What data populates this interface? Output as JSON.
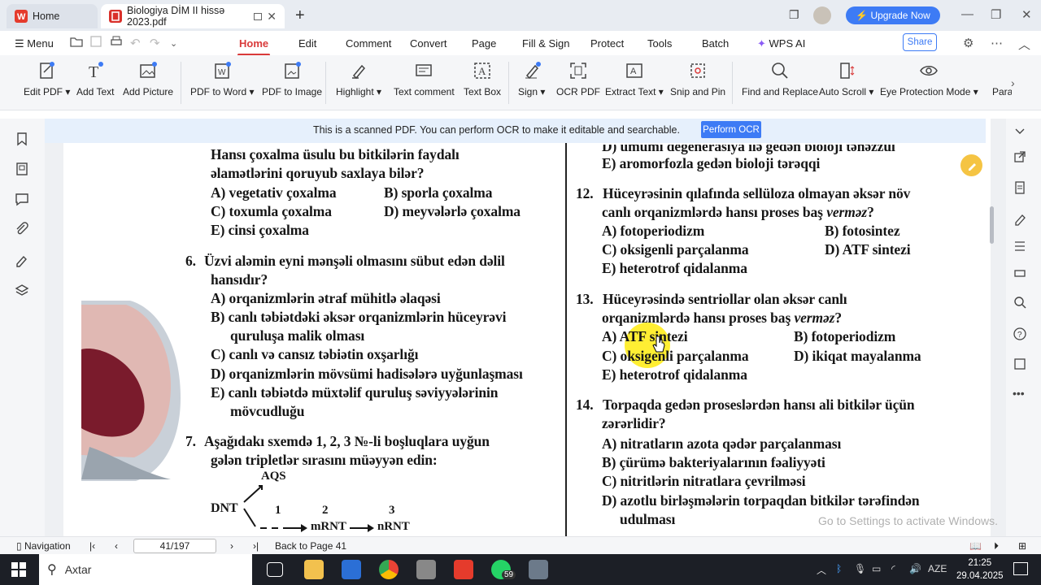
{
  "tabs": {
    "home": "Home",
    "doc": "Biologiya DİM II hissə 2023.pdf"
  },
  "upgrade": "Upgrade Now",
  "menu": {
    "menu_label": "Menu",
    "items": [
      "Home",
      "Edit",
      "Comment",
      "Convert",
      "Page",
      "Fill & Sign",
      "Protect",
      "Tools",
      "Batch",
      "WPS AI"
    ],
    "share": "Share"
  },
  "ribbon": {
    "items": [
      "Edit PDF",
      "Add Text",
      "Add Picture",
      "PDF to Word",
      "PDF to Image",
      "Highlight",
      "Text comment",
      "Text Box",
      "Sign",
      "OCR PDF",
      "Extract Text",
      "Snip and Pin",
      "Find and Replace",
      "Auto Scroll",
      "Eye Protection Mode",
      "Para"
    ]
  },
  "ocr": {
    "message": "This is a scanned PDF. You can perform OCR to make it editable and searchable.",
    "button": "Perform OCR"
  },
  "doc": {
    "left": [
      "Hansı çoxalma üsulu bu bitkilərin faydalı",
      "əlamətlərini qoruyub saxlaya bilər?",
      "A) vegetativ çoxalma",
      "B) sporla çoxalma",
      "C) toxumla çoxalma",
      "D) meyvələrlə çoxalma",
      "E) cinsi çoxalma",
      "6.",
      "Üzvi aləmin eyni mənşəli olmasını sübut edən dəlil",
      "hansıdır?",
      "A) orqanizmlərin ətraf mühitlə əlaqəsi",
      "B) canlı təbiətdəki əksər orqanizmlərin hüceyrəvi",
      "quruluşa malik olması",
      "C) canlı və cansız təbiətin oxşarlığı",
      "D) orqanizmlərin mövsümi hadisələrə uyğunlaşması",
      "E) canlı təbiətdə müxtəlif quruluş səviyyələrinin",
      "mövcudluğu",
      "7.",
      "Aşağıdakı sxemdə 1, 2, 3 №-li boşluqlara uyğun",
      "gələn tripletlər sırasını müəyyən edin:",
      "AQS",
      "DNT",
      "1",
      "2",
      "3",
      "mRNT",
      "nRNT"
    ],
    "right": [
      "D) ümumi degenerasiya ilə gedən bioloji tənəzzül",
      "E) aromorfozla gedən bioloji tərəqqi",
      "12.",
      "Hüceyrəsinin qılafında sellüloza olmayan əksər növ",
      "canlı orqanizmlərdə hansı proses baş ",
      "verməz",
      "?",
      "A) fotoperiodizm",
      "B) fotosintez",
      "C) oksigenli parçalanma",
      "D) ATF sintezi",
      "E) heterotrof qidalanma",
      "13.",
      "Hüceyrəsində sentriollar olan əksər canlı",
      "orqanizmlərdə hansı proses baş ",
      "verməz",
      "?",
      "A) ATF sintezi",
      "B) fotoperiodizm",
      "C) oksigenli parçalanma",
      "D) ikiqat mayalanma",
      "E) heterotrof qidalanma",
      "14.",
      "Torpaqda gedən proseslərdən hansı ali bitkilər üçün",
      "zərərlidir?",
      "A) nitratların azota qədər parçalanması",
      "B) çürümə bakteriyalarının fəaliyyəti",
      "C) nitritlərin nitratlara çevrilməsi",
      "D) azotlu birləşmələrin torpaqdan bitkilər tərəfindən",
      "udulması"
    ]
  },
  "watermark": "Go to Settings to activate Windows.",
  "nav": {
    "label": "Navigation",
    "page": "41/197",
    "back": "Back to Page 41"
  },
  "taskbar": {
    "search": "Axtar",
    "whatsapp_badge": "59",
    "lang": "AZE",
    "time": "21:25",
    "date": "29.04.2025"
  },
  "colors": {
    "accent": "#d93a3a",
    "blue": "#3d7bf5"
  }
}
